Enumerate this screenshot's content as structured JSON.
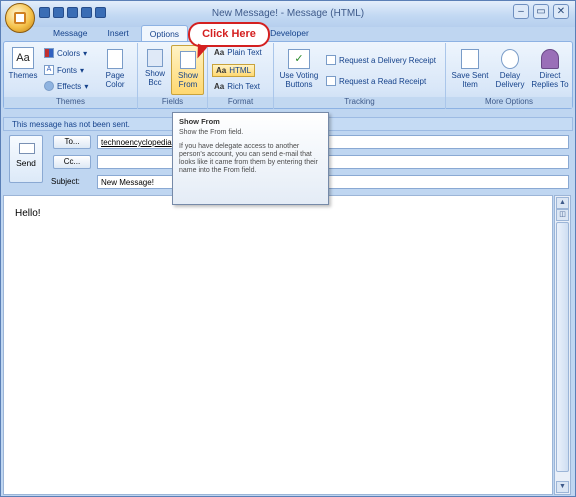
{
  "window": {
    "title": "New Message! - Message (HTML)",
    "min": "–",
    "max": "▭",
    "close": "✕"
  },
  "tabs": [
    "Message",
    "Insert",
    "Options",
    "Developer"
  ],
  "callout": "Click Here",
  "ribbon": {
    "themes_group": {
      "label": "Themes",
      "themes": "Themes",
      "colors": "Colors",
      "fonts": "Fonts",
      "effects": "Effects",
      "page_color_line1": "Page",
      "page_color_line2": "Color"
    },
    "fields_group": {
      "label": "Fields",
      "show_bcc_line1": "Show",
      "show_bcc_line2": "Bcc",
      "show_from_line1": "Show",
      "show_from_line2": "From"
    },
    "format_group": {
      "label": "Format",
      "plain_text": "Plain Text",
      "html": "HTML",
      "rich_text": "Rich Text"
    },
    "tracking_group": {
      "label": "Tracking",
      "voting_line1": "Use Voting",
      "voting_line2": "Buttons",
      "delivery_receipt": "Request a Delivery Receipt",
      "read_receipt": "Request a Read Receipt"
    },
    "more_group": {
      "label": "More Options",
      "save_sent_line1": "Save Sent",
      "save_sent_line2": "Item",
      "delay_line1": "Delay",
      "delay_line2": "Delivery",
      "direct_line1": "Direct",
      "direct_line2": "Replies To"
    }
  },
  "info_bar": "This message has not been sent.",
  "compose": {
    "send": "Send",
    "to_button": "To...",
    "cc_button": "Cc...",
    "subject_label": "Subject:",
    "to_value": "technoencyclopedia",
    "cc_value": "",
    "subject_value": "New Message!",
    "body_text": "Hello!"
  },
  "tooltip": {
    "title": "Show From",
    "line1": "Show the From field.",
    "line2": "If you have delegate access to another person's account, you can send e-mail that looks like it came from them by entering their name into the From field."
  },
  "colors": {
    "accent": "#15428b",
    "callout": "#d42020",
    "highlight": "#ffd870"
  }
}
